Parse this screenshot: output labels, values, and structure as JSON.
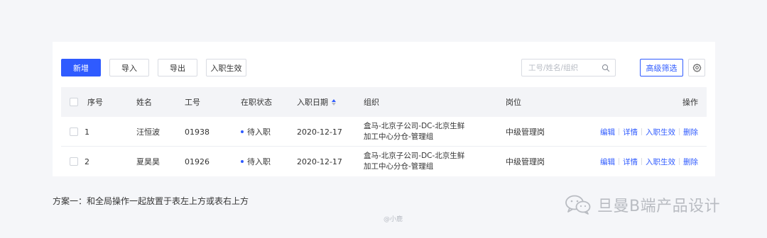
{
  "toolbar": {
    "new_label": "新增",
    "import_label": "导入",
    "export_label": "导出",
    "effective_label": "入职生效",
    "search_placeholder": "工号/姓名/组织",
    "filter_label": "高级筛选"
  },
  "table": {
    "headers": {
      "no": "序号",
      "name": "姓名",
      "id": "工号",
      "status": "在职状态",
      "date": "入职日期",
      "org": "组织",
      "position": "岗位",
      "ops": "操作"
    },
    "rows": [
      {
        "no": "1",
        "name": "汪恒波",
        "id": "01938",
        "status": "待入职",
        "date": "2020-12-17",
        "org_line1": "盒马-北京子公司-DC-北京生鲜",
        "org_line2": "加工中心分仓-管理组",
        "position": "中级管理岗"
      },
      {
        "no": "2",
        "name": "夏昊昊",
        "id": "01926",
        "status": "待入职",
        "date": "2020-12-17",
        "org_line1": "盒马-北京子公司-DC-北京生鲜",
        "org_line2": "加工中心分仓-管理组",
        "position": "中级管理岗"
      }
    ],
    "row_actions": {
      "edit": "编辑",
      "detail": "详情",
      "effective": "入职生效",
      "delete": "删除"
    }
  },
  "caption": "方案一：和全局操作一起放置于表左上方或表右上方",
  "credit": "@小鹿",
  "watermark": "旦曼B端产品设计",
  "colors": {
    "primary": "#2f5bff",
    "background": "#f5f6f9",
    "header_bg": "#f3f4f7"
  }
}
